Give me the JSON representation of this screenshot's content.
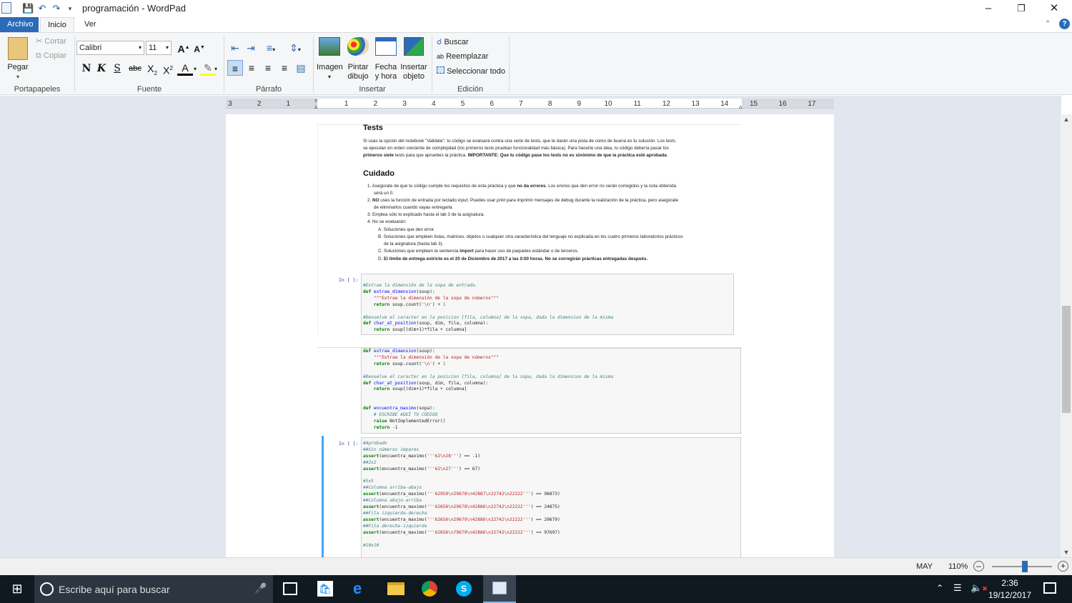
{
  "window": {
    "title": "programación - WordPad"
  },
  "tabs": [
    {
      "label": "Archivo"
    },
    {
      "label": "Inicio"
    },
    {
      "label": "Ver"
    }
  ],
  "ribbon": {
    "clipboard": {
      "paste": "Pegar",
      "cut": "Cortar",
      "copy": "Copiar",
      "group": "Portapapeles"
    },
    "font": {
      "family": "Calibri",
      "size": "11",
      "group": "Fuente",
      "bold": "N",
      "italic": "K",
      "underline": "S",
      "strike": "abc"
    },
    "paragraph": {
      "group": "Párrafo"
    },
    "insert": {
      "image": "Imagen",
      "paint1": "Pintar",
      "paint2": "dibujo",
      "date1": "Fecha",
      "date2": "y hora",
      "obj1": "Insertar",
      "obj2": "objeto",
      "group": "Insertar"
    },
    "edit": {
      "find": "Buscar",
      "replace": "Reemplazar",
      "selectall": "Seleccionar todo",
      "group": "Edición"
    }
  },
  "ruler": {
    "ticks": [
      "3",
      "2",
      "1",
      "1",
      "2",
      "3",
      "4",
      "5",
      "6",
      "7",
      "8",
      "9",
      "10",
      "11",
      "12",
      "13",
      "14",
      "15",
      "16",
      "17"
    ]
  },
  "doc": {
    "tests_heading": "Tests",
    "tests_p1": "Si usas la opción del notebook \"Validate\", tu código se evaluará contra una serie de tests, que te darán una pista de cómo de buena es tu solución. Los tests",
    "tests_p2": "se ejecutan en orden creciente de complejidad (los primeros tests prueban funcionalidad más básica). Para hacerte una idea, tu código debería pasar los",
    "tests_p3a": "primeros siete",
    "tests_p3b": " tests para que apruebes la práctica. ",
    "tests_p3c": "IMPORTANTE: Que tu código pase los tests no es sinónimo de que la práctica esté aprobada",
    "tests_p3d": ".",
    "cuidado_heading": "Cuidado",
    "li1a": "1. Asegúrate de que tu código cumple los requisitos de esta práctica y que ",
    "li1b": "no da errores",
    "li1c": ". Los envíos que den error no serán corregidos y la nota obtenida",
    "li1d": "será un 0.",
    "li2a": "2. ",
    "li2b": "NO",
    "li2c": " uses la función de entrada por teclado ",
    "li2d": "input",
    "li2e": ". Puedes usar ",
    "li2f": "print",
    "li2g": " para imprimir mensajes de debug durante la realización de la práctica, pero asegúrate",
    "li2h": "de eliminarlos cuando vayas entregarla.",
    "li3": "3. Emplea sólo lo explicado hasta el lab 3 de la asignatura.",
    "li4": "4. No se evaluarán:",
    "liA": "A. Soluciones que den error.",
    "liB1": "B. Soluciones que empleen listas, matrices, objetos o cualquier otra característica del lenguaje no explicada en los cuatro primeros laboratorios prácticos",
    "liB2": "de la asignatura (hasta lab 3).",
    "liC1": "C. Soluciones que empleen la sentencia ",
    "liC2": "import",
    "liC3": " para hacer uso de paquetes estándar o de terceros.",
    "liD1": "D. ",
    "liD2": "El límite de entrega estricto es el 20 de Diciembre de 2017 a las 0:00 horas. No se corregirán prácticas entregadas después.",
    "prompt": "In [ ]:",
    "c1_l1": "#Extrae la dimensión de la sopa de entrada.",
    "c1_l2a": "def ",
    "c1_l2b": "extrae_dimension",
    "c1_l2c": "(soup):",
    "c1_l3": "    \"\"\"Extrae la dimensión de la sopa de números\"\"\"",
    "c1_l4a": "    return",
    "c1_l4b": " soup.count(",
    "c1_l4c": "'\\n'",
    "c1_l4d": ") + ",
    "c1_l4e": "1",
    "c1_l5": "#Devuelve el caracter en la posicion [fila, columna] de la sopa, dada la dimension de la misma",
    "c1_l6a": "def ",
    "c1_l6b": "char_at_position",
    "c1_l6c": "(soup, dim, fila, columna):",
    "c1_l7a": "    return",
    "c1_l7b": " soup[(dim+1)*fila + columna]",
    "c2_l1": "    raise",
    "c2_l1b": " NotImplementedError()",
    "c2_l2": "    return",
    "c2_l2b": " -1",
    "c2_def": "def ",
    "c2_fn": "encuentra_maximo",
    "c2_args": "(sopa):",
    "c2_cm": "    # ESCRIBE AQUÍ TU CÓDIGO",
    "t_l1": "#Aprobado",
    "t_l2": "##Sin números impares",
    "t_l3a": "assert",
    "t_l3b": "(encuentra_maximo(",
    "t_l3c": "'''62\\n28'''",
    "t_l3d": ") == -1)",
    "t_l4": "##2x2",
    "t_l5a": "assert",
    "t_l5b": "(encuentra_maximo(",
    "t_l5c": "'''62\\n27'''",
    "t_l5d": ") == 67)",
    "t_l6": "#5x5",
    "t_l7": "##Columna arriba-abajo",
    "t_l8c": "'''62959\\n29678\\n42887\\n22742\\n22322'''",
    "t_l8d": ") == 96873)",
    "t_l9": "##Columna abajo-arriba",
    "t_l10c": "'''62656\\n29678\\n42886\\n22742\\n22222'''",
    "t_l10d": ") == 24875)",
    "t_l11": "##Fila izquierda-derecha",
    "t_l12c": "'''62656\\n29679\\n42886\\n22742\\n22222'''",
    "t_l12d": ") == 29679)",
    "t_l13": "##Fila derecha-izquierda",
    "t_l14c": "'''62656\\n79679\\n42886\\n22742\\n22222'''",
    "t_l14d": ") == 97697)",
    "t_l15": "#10x10"
  },
  "status": {
    "caps": "MAY",
    "zoom": "110%",
    "zoom_level": 0.55
  },
  "taskbar": {
    "search_placeholder": "Escribe aquí para buscar",
    "time": "2:36",
    "date": "19/12/2017"
  }
}
